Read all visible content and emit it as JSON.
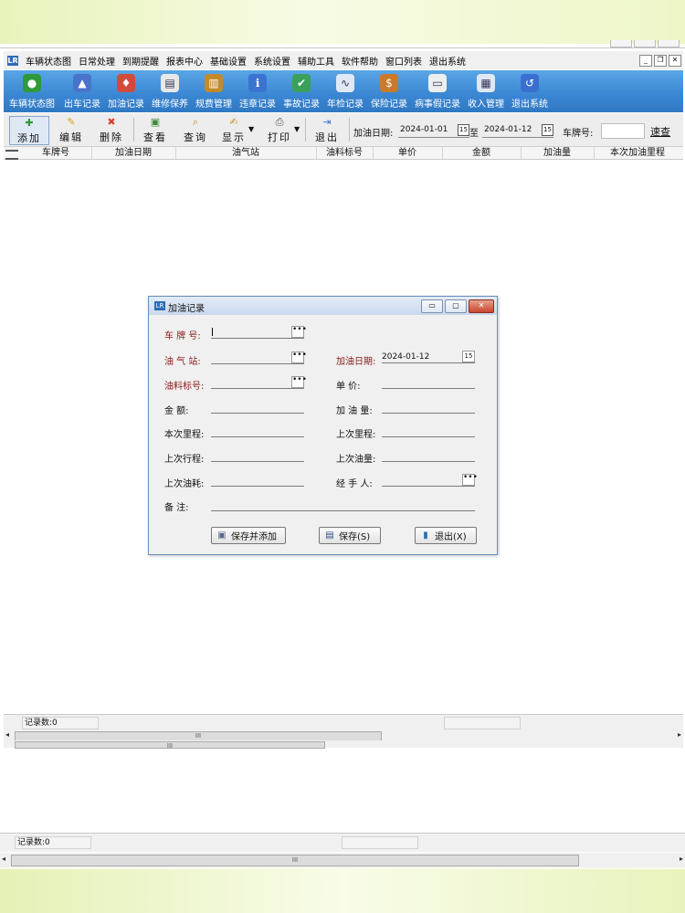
{
  "menu": {
    "items": [
      "车辆状态图",
      "日常处理",
      "到期提醒",
      "报表中心",
      "基础设置",
      "系统设置",
      "辅助工具",
      "软件帮助",
      "窗口列表",
      "退出系统"
    ],
    "app_icon": "LR"
  },
  "modules": [
    {
      "label": "车辆状态图",
      "icon": "vehicle-status-icon",
      "color": "#2e9a3a",
      "glyph": "●"
    },
    {
      "label": "出车记录",
      "icon": "dispatch-icon",
      "color": "#4a74c9",
      "glyph": "▲"
    },
    {
      "label": "加油记录",
      "icon": "fuel-icon",
      "color": "#d24a3a",
      "glyph": "♦"
    },
    {
      "label": "维修保养",
      "icon": "maintenance-icon",
      "color": "#e8e8e8",
      "glyph": "▤"
    },
    {
      "label": "规费管理",
      "icon": "fees-icon",
      "color": "#c48a2a",
      "glyph": "▥"
    },
    {
      "label": "违章记录",
      "icon": "violation-icon",
      "color": "#3a74d0",
      "glyph": "ℹ"
    },
    {
      "label": "事故记录",
      "icon": "accident-icon",
      "color": "#3aa05a",
      "glyph": "✔"
    },
    {
      "label": "年检记录",
      "icon": "inspection-icon",
      "color": "#dfe8f5",
      "glyph": "∿"
    },
    {
      "label": "保险记录",
      "icon": "insurance-icon",
      "color": "#c87a2a",
      "glyph": "$"
    },
    {
      "label": "病事假记录",
      "icon": "leave-icon",
      "color": "#eeeeee",
      "glyph": "▭"
    },
    {
      "label": "收入管理",
      "icon": "income-icon",
      "color": "#dfe8f5",
      "glyph": "▦"
    },
    {
      "label": "退出系统",
      "icon": "exit-icon",
      "color": "#3a6fd0",
      "glyph": "↺"
    }
  ],
  "actions": [
    {
      "label": "添加",
      "icon": "add-icon",
      "glyph": "✚"
    },
    {
      "label": "编辑",
      "icon": "edit-icon",
      "glyph": "✎"
    },
    {
      "label": "删除",
      "icon": "delete-icon",
      "glyph": "✖"
    },
    {
      "label": "查看",
      "icon": "view-icon",
      "glyph": "▣"
    },
    {
      "label": "查询",
      "icon": "query-icon",
      "glyph": "⌕"
    },
    {
      "label": "显示",
      "icon": "display-icon",
      "glyph": "✍"
    },
    {
      "label": "打印",
      "icon": "print-icon",
      "glyph": "⎙"
    },
    {
      "label": "退出",
      "icon": "exit-door-icon",
      "glyph": "⇥"
    }
  ],
  "filter": {
    "date_label": "加油日期:",
    "date_from": "2024-01-01",
    "to_label": "至",
    "date_to": "2024-01-12",
    "plate_label": "车牌号:",
    "plate_value": "",
    "fast_search": "速查",
    "cal_glyph": "15"
  },
  "grid": {
    "columns": [
      "车牌号",
      "加油日期",
      "油气站",
      "油料标号",
      "单价",
      "金额",
      "加油量",
      "本次加油里程"
    ]
  },
  "status": {
    "record_count": "记录数:0"
  },
  "dialog": {
    "title": "加油记录",
    "app_icon": "LR",
    "fields": {
      "plate": {
        "label": "车 牌 号:",
        "value": ""
      },
      "station": {
        "label": "油 气 站:",
        "value": ""
      },
      "fuel_date": {
        "label": "加油日期:",
        "value": "2024-01-12"
      },
      "grade": {
        "label": "油料标号:",
        "value": ""
      },
      "unit_price": {
        "label": "单    价:",
        "value": ""
      },
      "amount": {
        "label": "金    额:",
        "value": ""
      },
      "volume": {
        "label": "加 油 量:",
        "value": ""
      },
      "mileage_now": {
        "label": "本次里程:",
        "value": ""
      },
      "mileage_last": {
        "label": "上次里程:",
        "value": ""
      },
      "trip_last": {
        "label": "上次行程:",
        "value": ""
      },
      "fuel_last": {
        "label": "上次油量:",
        "value": ""
      },
      "consumption_last": {
        "label": "上次油耗:",
        "value": ""
      },
      "handler": {
        "label": "经 手 人:",
        "value": ""
      },
      "remark": {
        "label": "备    注:",
        "value": ""
      }
    },
    "ellipsis": "•••",
    "buttons": {
      "save_add": "保存并添加",
      "save": "保存(S)",
      "exit": "退出(X)"
    }
  }
}
